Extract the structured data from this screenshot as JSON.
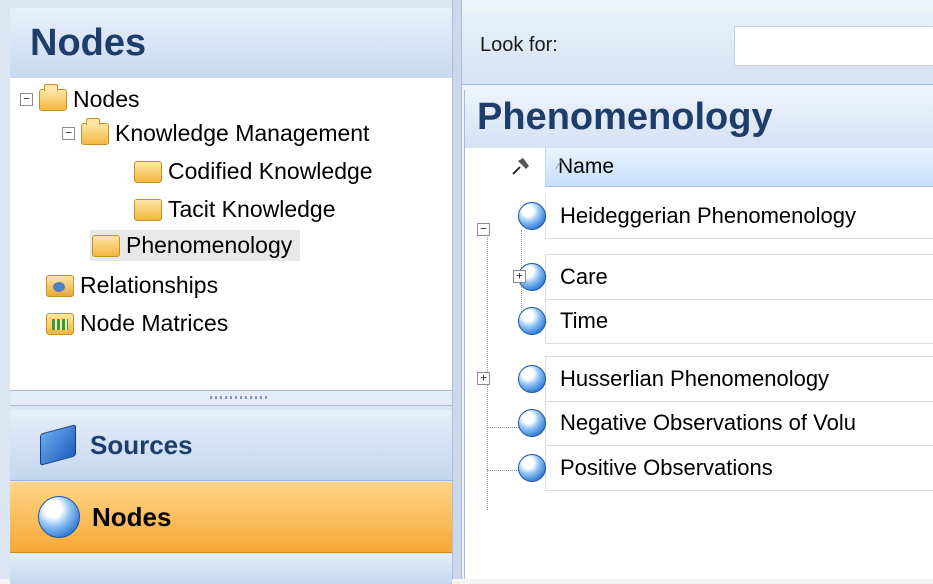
{
  "left_panel": {
    "title": "Nodes",
    "tree": [
      {
        "label": "Nodes",
        "expander": "−"
      },
      {
        "label": "Knowledge Management",
        "expander": "−"
      },
      {
        "label": "Codified Knowledge"
      },
      {
        "label": "Tacit Knowledge"
      },
      {
        "label": "Phenomenology"
      },
      {
        "label": "Relationships"
      },
      {
        "label": "Node Matrices"
      }
    ]
  },
  "nav": {
    "sources": "Sources",
    "nodes": "Nodes"
  },
  "search": {
    "label": "Look for:",
    "value": ""
  },
  "content": {
    "title": "Phenomenology",
    "column_name": "Name",
    "rows": [
      {
        "label": "Heideggerian Phenomenology",
        "expander": "−"
      },
      {
        "label": "Care",
        "expander": "+"
      },
      {
        "label": "Time"
      },
      {
        "label": "Husserlian Phenomenology",
        "expander": "+"
      },
      {
        "label": "Negative Observations of Volu"
      },
      {
        "label": "Positive Observations"
      }
    ]
  },
  "colors": {
    "title_blue": "#1f3d6b",
    "selected_nav": "#f7a836",
    "header_blue": "#c6e0fb"
  }
}
